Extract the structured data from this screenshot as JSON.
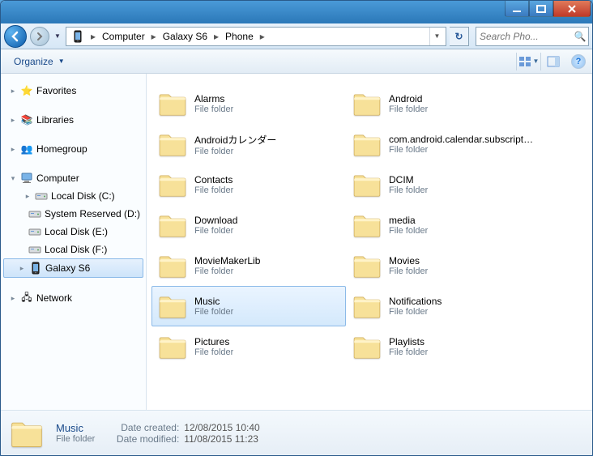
{
  "breadcrumb": [
    "Computer",
    "Galaxy S6",
    "Phone"
  ],
  "search": {
    "placeholder": "Search Pho..."
  },
  "toolbar": {
    "organize": "Organize"
  },
  "sidebar": {
    "favorites": "Favorites",
    "libraries": "Libraries",
    "homegroup": "Homegroup",
    "computer": "Computer",
    "computer_children": [
      "Local Disk (C:)",
      "System Reserved (D:)",
      "Local Disk (E:)",
      "Local Disk (F:)",
      "Galaxy S6"
    ],
    "network": "Network"
  },
  "file_type_label": "File folder",
  "folders": [
    {
      "name": "Alarms"
    },
    {
      "name": "Android"
    },
    {
      "name": "Androidカレンダー"
    },
    {
      "name": "com.android.calendar.subscription.a"
    },
    {
      "name": "Contacts"
    },
    {
      "name": "DCIM"
    },
    {
      "name": "Download"
    },
    {
      "name": "media"
    },
    {
      "name": "MovieMakerLib"
    },
    {
      "name": "Movies"
    },
    {
      "name": "Music",
      "selected": true
    },
    {
      "name": "Notifications"
    },
    {
      "name": "Pictures"
    },
    {
      "name": "Playlists"
    }
  ],
  "details": {
    "name": "Music",
    "type": "File folder",
    "created_label": "Date created:",
    "created": "12/08/2015 10:40",
    "modified_label": "Date modified:",
    "modified": "11/08/2015 11:23"
  }
}
